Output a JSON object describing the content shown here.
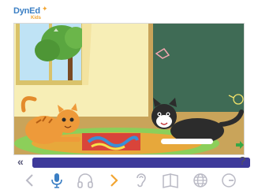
{
  "logo": {
    "brand": "DynEd",
    "sub": "Kids",
    "star": "✦"
  },
  "scene": {
    "description_icon": "lesson-scene-image",
    "colors": {
      "wall": "#f7eeb6",
      "chalkboard": "#3f6b55",
      "floor": "#c9a45a",
      "rug": "#e7a83b",
      "window_frame": "#d9c26a"
    }
  },
  "progress": {
    "value": 1.0,
    "rewind_label": "«",
    "help_label": "?"
  },
  "toolbar": {
    "items": [
      {
        "name": "back-icon",
        "enabled": false
      },
      {
        "name": "microphone-icon",
        "enabled": true
      },
      {
        "name": "headphones-icon",
        "enabled": false
      },
      {
        "name": "next-icon",
        "enabled": true
      },
      {
        "name": "ear-icon",
        "enabled": false
      },
      {
        "name": "book-icon",
        "enabled": false
      },
      {
        "name": "globe-icon",
        "enabled": false
      },
      {
        "name": "clock-icon",
        "enabled": false
      }
    ]
  },
  "colors": {
    "accent_blue": "#3b7fc4",
    "accent_orange": "#f2a531",
    "progress": "#3e3a9a",
    "disabled": "#b9b9c4"
  }
}
